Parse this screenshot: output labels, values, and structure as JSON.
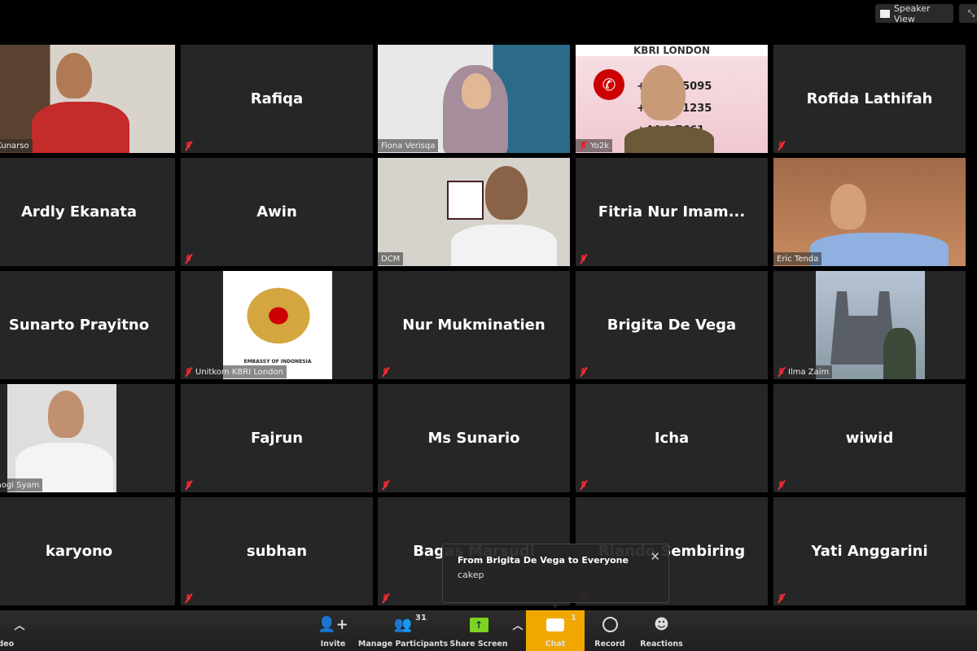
{
  "top_bar": {
    "speaker_view_label": "Speaker View",
    "speaker_view_icon": "grid-icon",
    "fullscreen_icon": "exit-fullscreen-icon"
  },
  "tiles": [
    {
      "name": "Kunarso",
      "label": "ih Kunarso",
      "video": true,
      "muted": false
    },
    {
      "name": "Rafiqa",
      "label": "",
      "video": false,
      "muted": true
    },
    {
      "name": "Fiona Verisqa",
      "label": "Fiona Verisqa",
      "video": true,
      "muted": false
    },
    {
      "name": "Yo2k",
      "label": "Yo2k",
      "video": true,
      "muted": true,
      "background_text": {
        "title": "KBRI LONDON",
        "line1": "+44 49 5095",
        "line2": "+4 222 1235",
        "line3": "+44 9 7661"
      }
    },
    {
      "name": "Rofida Lathifah",
      "label": "",
      "video": false,
      "muted": true
    },
    {
      "name": "Ardly Ekanata",
      "label": "",
      "video": false,
      "muted": true
    },
    {
      "name": "Awin",
      "label": "",
      "video": false,
      "muted": true
    },
    {
      "name": "DCM",
      "label": "DCM",
      "video": true,
      "muted": false,
      "active_speaker": true
    },
    {
      "name": "Fitria Nur Imam...",
      "label": "",
      "video": false,
      "muted": true
    },
    {
      "name": "Eric Tenda",
      "label": "Eric Tenda",
      "video": true,
      "muted": false
    },
    {
      "name": "Sunarto Prayitno",
      "label": "",
      "video": false,
      "muted": true
    },
    {
      "name": "Unitkom KBRI London",
      "label": "Unitkom KBRI London",
      "video": true,
      "muted": true,
      "logo_text": "EMBASSY OF INDONESIA"
    },
    {
      "name": "Nur Mukminatien",
      "label": "",
      "video": false,
      "muted": true
    },
    {
      "name": "Brigita De Vega",
      "label": "",
      "video": false,
      "muted": true
    },
    {
      "name": "Ilma Zaim",
      "label": "Ilma Zaim",
      "video": true,
      "muted": true
    },
    {
      "name": "Shaogi Syam",
      "label": "Shaogi Syam",
      "video": true,
      "muted": false
    },
    {
      "name": "Fajrun",
      "label": "",
      "video": false,
      "muted": true
    },
    {
      "name": "Ms Sunario",
      "label": "",
      "video": false,
      "muted": true
    },
    {
      "name": "Icha",
      "label": "",
      "video": false,
      "muted": true
    },
    {
      "name": "wiwid",
      "label": "",
      "video": false,
      "muted": true
    },
    {
      "name": "karyono",
      "label": "",
      "video": false,
      "muted": true
    },
    {
      "name": "subhan",
      "label": "",
      "video": false,
      "muted": true
    },
    {
      "name": "Bagas Marsudi",
      "label": "",
      "video": false,
      "muted": true
    },
    {
      "name": "Riando Sembiring",
      "label": "",
      "video": false,
      "muted": true
    },
    {
      "name": "Yati Anggarini",
      "label": "",
      "video": false,
      "muted": true
    }
  ],
  "chat_popup": {
    "from": "From Brigita De Vega to Everyone",
    "message": "cakep",
    "close_icon": "close-icon"
  },
  "toolbar": {
    "video_label": "Video",
    "invite": "Invite",
    "participants": "Manage Participants",
    "participants_count": "31",
    "share": "Share Screen",
    "chat": "Chat",
    "chat_count": "1",
    "record": "Record",
    "reactions": "Reactions",
    "chat_active_color": "#f0a800",
    "share_color": "#7ed321"
  }
}
